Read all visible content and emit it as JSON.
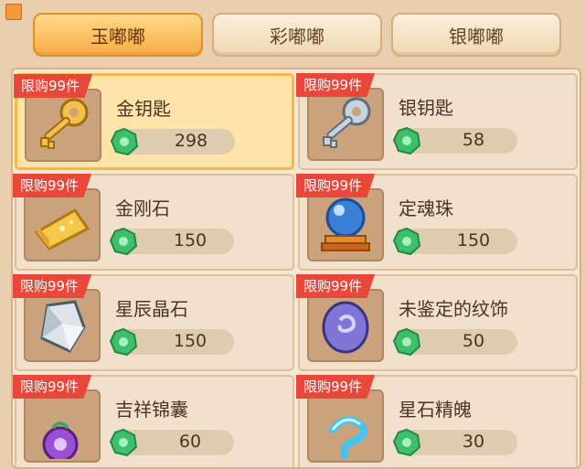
{
  "tabs": [
    {
      "label": "玉嘟嘟",
      "active": true
    },
    {
      "label": "彩嘟嘟",
      "active": false
    },
    {
      "label": "银嘟嘟",
      "active": false
    }
  ],
  "currency_icon": "green-jade-coin-icon",
  "items": [
    {
      "badge": "限购99件",
      "name": "金钥匙",
      "price": "298",
      "icon": "gold-key-icon",
      "selected": true
    },
    {
      "badge": "限购99件",
      "name": "银钥匙",
      "price": "58",
      "icon": "silver-key-icon",
      "selected": false
    },
    {
      "badge": "限购99件",
      "name": "金刚石",
      "price": "150",
      "icon": "diamond-stone-icon",
      "selected": false
    },
    {
      "badge": "限购99件",
      "name": "定魂珠",
      "price": "150",
      "icon": "crystal-orb-icon",
      "selected": false
    },
    {
      "badge": "限购99件",
      "name": "星辰晶石",
      "price": "150",
      "icon": "star-crystal-icon",
      "selected": false
    },
    {
      "badge": "限购99件",
      "name": "未鉴定的纹饰",
      "price": "50",
      "icon": "unidentified-emblem-icon",
      "selected": false
    },
    {
      "badge": "限购99件",
      "name": "吉祥锦囊",
      "price": "60",
      "icon": "lucky-pouch-icon",
      "selected": false
    },
    {
      "badge": "限购99件",
      "name": "星石精魄",
      "price": "30",
      "icon": "star-soul-icon",
      "selected": false
    }
  ],
  "colors": {
    "active_tab": "#f6ad44",
    "limit_badge": "#e8473a",
    "selected_card": "#fee4a8",
    "currency_green": "#3fbf6a"
  }
}
